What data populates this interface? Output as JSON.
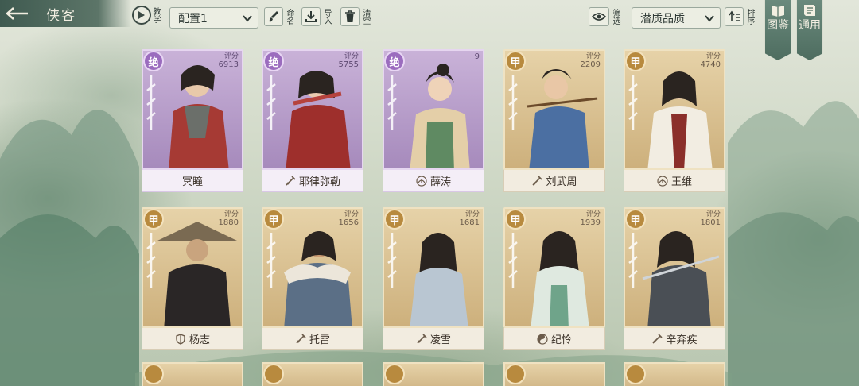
{
  "header": {
    "title": "侠客",
    "tutorial_label": "教学",
    "config_select": "配置1",
    "rename_label": "命名",
    "import_label": "导入",
    "clear_label": "清空",
    "filter_label": "筛选",
    "sort_select": "潜质品质",
    "sort_label": "排序",
    "codex_label": "图鉴",
    "general_label": "通用"
  },
  "colors": {
    "jue": "#9b6cbe",
    "jia": "#b88a3e",
    "header": "#4e6d60"
  },
  "cards": [
    {
      "name": "冥瞳",
      "grade": "绝",
      "score_label": "评分",
      "score": "6913",
      "icon": "none"
    },
    {
      "name": "耶律弥勒",
      "grade": "绝",
      "score_label": "评分",
      "score": "5755",
      "icon": "dagger-icon"
    },
    {
      "name": "薛涛",
      "grade": "绝",
      "score_label": "",
      "score": "9",
      "icon": "lotus-icon"
    },
    {
      "name": "刘武周",
      "grade": "甲",
      "score_label": "评分",
      "score": "2209",
      "icon": "dagger-icon"
    },
    {
      "name": "王维",
      "grade": "甲",
      "score_label": "评分",
      "score": "4740",
      "icon": "lotus-icon"
    },
    {
      "name": "杨志",
      "grade": "甲",
      "score_label": "评分",
      "score": "1880",
      "icon": "shield-icon"
    },
    {
      "name": "托雷",
      "grade": "甲",
      "score_label": "评分",
      "score": "1656",
      "icon": "dagger-icon"
    },
    {
      "name": "凌雪",
      "grade": "甲",
      "score_label": "评分",
      "score": "1681",
      "icon": "dagger-icon"
    },
    {
      "name": "纪怜",
      "grade": "甲",
      "score_label": "评分",
      "score": "1939",
      "icon": "yin-yang-icon"
    },
    {
      "name": "辛弃疾",
      "grade": "甲",
      "score_label": "评分",
      "score": "1801",
      "icon": "dagger-icon"
    }
  ]
}
